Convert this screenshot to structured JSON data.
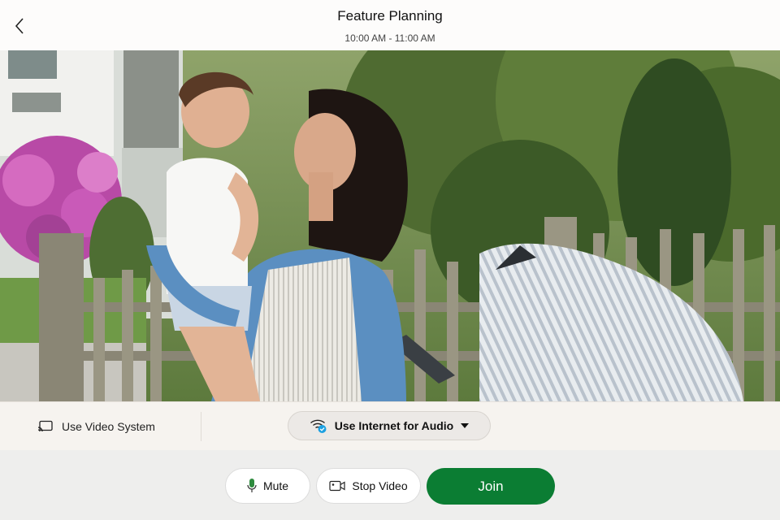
{
  "header": {
    "title": "Feature Planning",
    "time_range": "10:00 AM - 11:00 AM",
    "back_icon": "chevron-left-icon"
  },
  "preview": {
    "description_icon": "self-view-video"
  },
  "strip": {
    "video_system_label": "Use Video System",
    "video_system_icon": "screen-cast-icon",
    "audio_label": "Use Internet for Audio",
    "audio_icon": "wifi-icon",
    "audio_dropdown_icon": "caret-down-icon",
    "audio_badge_color": "#1ba0e1"
  },
  "controls": {
    "mute_label": "Mute",
    "mute_icon": "microphone-icon",
    "mute_icon_color": "#2e8b3e",
    "stop_video_label": "Stop Video",
    "stop_video_icon": "video-camera-icon",
    "join_label": "Join",
    "join_color": "#0b7d33"
  }
}
